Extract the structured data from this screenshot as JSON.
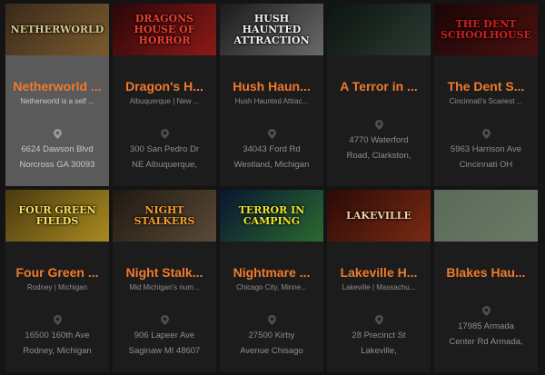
{
  "cards": [
    {
      "image_text": "NETHERWORLD",
      "image_colors": [
        "#3a2a1c",
        "#7a5a2c"
      ],
      "image_text_color": "#d8c890",
      "title": "Netherworld ...",
      "subtitle": "Netherworld is a self ...",
      "address_line1": "6624 Dawson Blvd",
      "address_line2": "Norcross GA 30093",
      "pin_icon": "map-pin-icon"
    },
    {
      "image_text": "DRAGONS HOUSE OF HORROR",
      "image_colors": [
        "#2a0608",
        "#8c1a18"
      ],
      "image_text_color": "#e84030",
      "title": "Dragon's H...",
      "subtitle": "Albuquerque | New ...",
      "address_line1": "300 San Pedro Dr",
      "address_line2": "NE Albuquerque,",
      "pin_icon": "map-pin-icon"
    },
    {
      "image_text": "HUSH HAUNTED ATTRACTION",
      "image_colors": [
        "#1a1a1a",
        "#6a6a6a"
      ],
      "image_text_color": "#f0f0f0",
      "title": "Hush Haun...",
      "subtitle": "Hush Haunted Attrac...",
      "address_line1": "34043 Ford Rd",
      "address_line2": "Westland, Michigan",
      "pin_icon": "map-pin-icon"
    },
    {
      "image_text": "",
      "image_colors": [
        "#0c1410",
        "#2c3a32"
      ],
      "image_text_color": "#3cc050",
      "title": "A Terror in ...",
      "subtitle": "",
      "address_line1": "4770 Waterford",
      "address_line2": "Road, Clarkston,",
      "pin_icon": "map-pin-icon"
    },
    {
      "image_text": "THE DENT SCHOOLHOUSE",
      "image_colors": [
        "#1a0606",
        "#4a1010"
      ],
      "image_text_color": "#d02020",
      "title": "The Dent S...",
      "subtitle": "Cincinnati's Scariest ...",
      "address_line1": "5963 Harrison Ave",
      "address_line2": "Cincinnati OH",
      "pin_icon": "map-pin-icon"
    },
    {
      "image_text": "FOUR GREEN FIELDS",
      "image_colors": [
        "#4a3a10",
        "#a88a20"
      ],
      "image_text_color": "#f0e060",
      "title": "Four Green ...",
      "subtitle": "Rodney | Michigan",
      "address_line1": "16500 160th Ave",
      "address_line2": "Rodney, Michigan",
      "pin_icon": "map-pin-icon"
    },
    {
      "image_text": "NIGHT STALKERS",
      "image_colors": [
        "#201810",
        "#5a4a38"
      ],
      "image_text_color": "#f0a030",
      "title": "Night Stalk...",
      "subtitle": "Mid Michigan's num...",
      "address_line1": "906 Lapeer Ave",
      "address_line2": "Saginaw MI 48607",
      "pin_icon": "map-pin-icon"
    },
    {
      "image_text": "TERROR IN CAMPING",
      "image_colors": [
        "#0a1430",
        "#2a6a30"
      ],
      "image_text_color": "#f0e030",
      "title": "Nightmare ...",
      "subtitle": "Chicago City, Minne...",
      "address_line1": "27500 Kirby",
      "address_line2": "Avenue Chisago",
      "pin_icon": "map-pin-icon"
    },
    {
      "image_text": "LAKEVILLE",
      "image_colors": [
        "#2a0a06",
        "#7a2a14"
      ],
      "image_text_color": "#f0d0b0",
      "title": "Lakeville H...",
      "subtitle": "Lakeville | Massachu...",
      "address_line1": "28 Precinct St",
      "address_line2": "Lakeville,",
      "pin_icon": "map-pin-icon"
    },
    {
      "image_text": "",
      "image_colors": [
        "#5a6a58",
        "#6a7a66"
      ],
      "image_text_color": "#111111",
      "title": "Blakes Hau...",
      "subtitle": "",
      "address_line1": "17985 Armada",
      "address_line2": "Center Rd Armada,",
      "pin_icon": "map-pin-icon"
    }
  ],
  "colors": {
    "accent": "#f07a2c",
    "background": "#141414",
    "card": "#1c1c1c",
    "card_active": "#5a5a5a",
    "muted_text": "#8e8e8e"
  }
}
